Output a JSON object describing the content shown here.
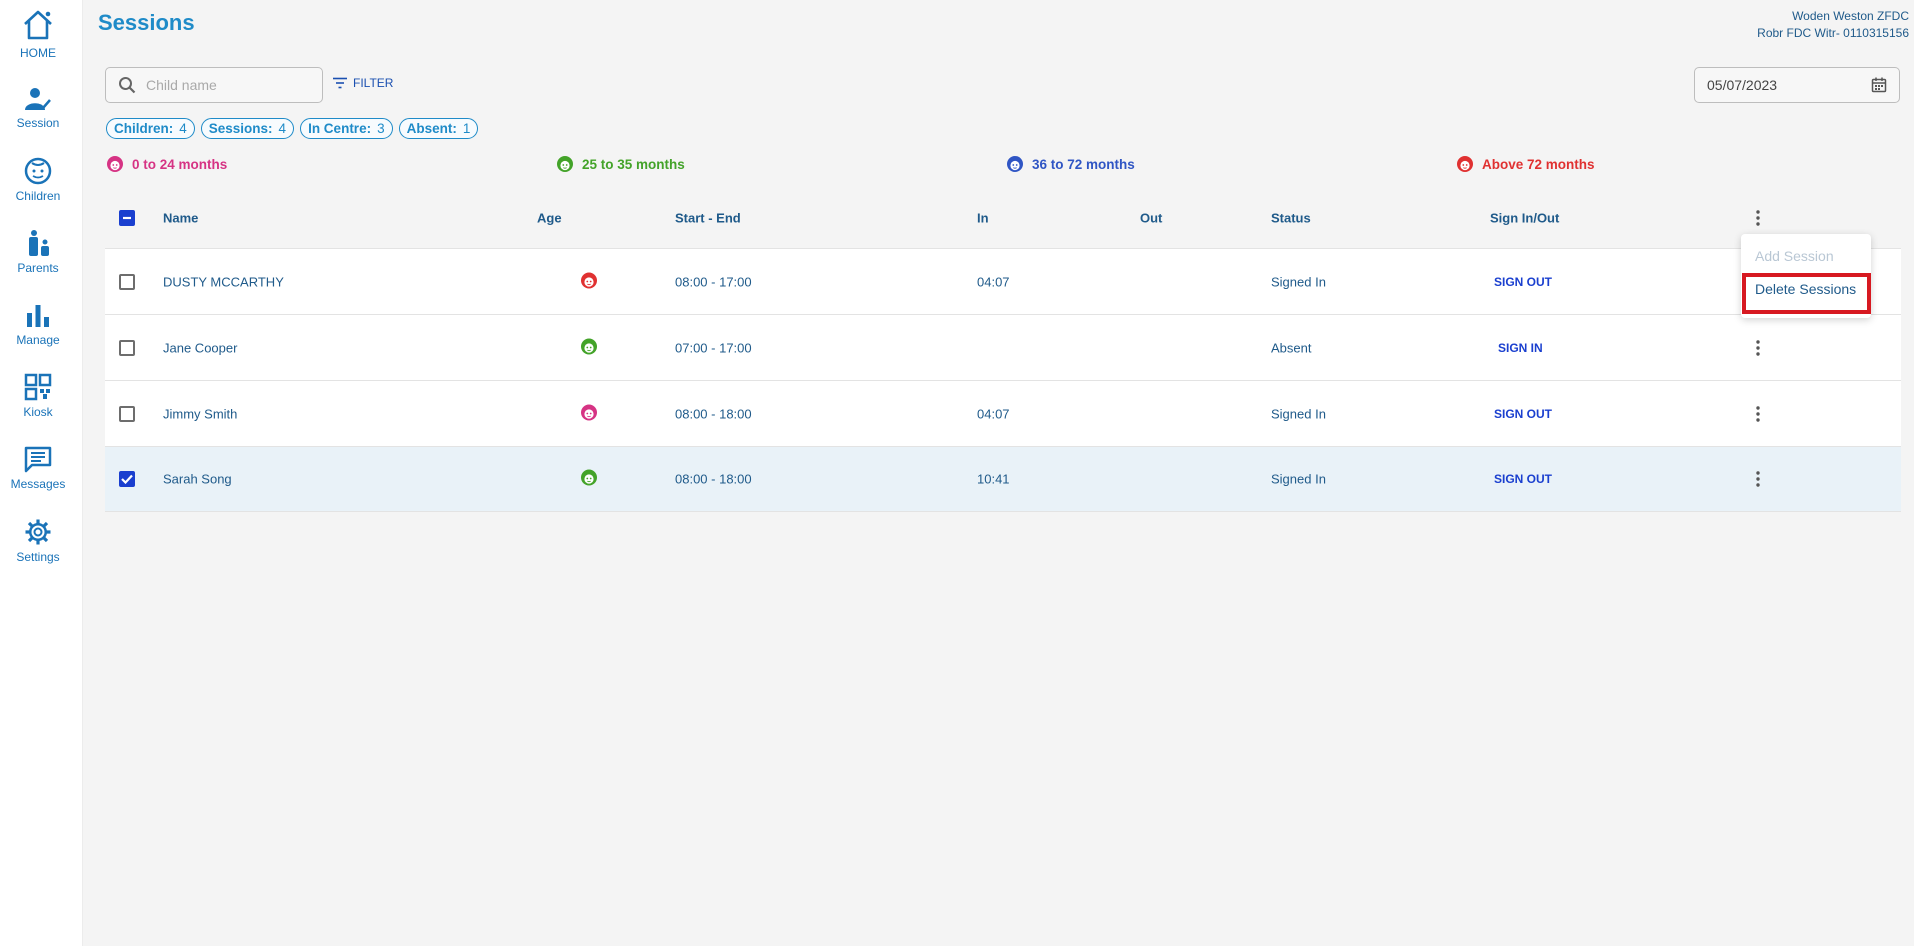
{
  "sidebar": {
    "items": [
      {
        "label": "HOME",
        "icon": "home-icon"
      },
      {
        "label": "Session",
        "icon": "session-icon"
      },
      {
        "label": "Children",
        "icon": "children-icon"
      },
      {
        "label": "Parents",
        "icon": "parents-icon"
      },
      {
        "label": "Manage",
        "icon": "bar-chart-icon"
      },
      {
        "label": "Kiosk",
        "icon": "qr-code-icon"
      },
      {
        "label": "Messages",
        "icon": "message-icon"
      },
      {
        "label": "Settings",
        "icon": "gear-icon"
      }
    ]
  },
  "header": {
    "title": "Sessions",
    "org_line1": "Woden Weston ZFDC",
    "org_line2": "Robr FDC Witr- 0110315156"
  },
  "toolbar": {
    "search_placeholder": "Child name",
    "filter_label": "FILTER",
    "date_value": "05/07/2023"
  },
  "summary": [
    {
      "label": "Children:",
      "value": "4"
    },
    {
      "label": "Sessions:",
      "value": "4"
    },
    {
      "label": "In Centre:",
      "value": "3"
    },
    {
      "label": "Absent:",
      "value": "1"
    }
  ],
  "age_legend": [
    {
      "label": "0 to 24 months",
      "color": "#d63384"
    },
    {
      "label": "25 to 35 months",
      "color": "#43a329"
    },
    {
      "label": "36 to 72 months",
      "color": "#2f55c4"
    },
    {
      "label": "Above 72 months",
      "color": "#e03131"
    }
  ],
  "table": {
    "columns": [
      "Name",
      "Age",
      "Start - End",
      "In",
      "Out",
      "Status",
      "Sign In/Out"
    ],
    "rows": [
      {
        "name": "DUSTY MCCARTHY",
        "age_group": 3,
        "time": "08:00 - 17:00",
        "in": "04:07",
        "out": "",
        "status": "Signed In",
        "action": "SIGN OUT",
        "checked": false
      },
      {
        "name": "Jane Cooper",
        "age_group": 1,
        "time": "07:00 - 17:00",
        "in": "",
        "out": "",
        "status": "Absent",
        "action": "SIGN IN",
        "checked": false
      },
      {
        "name": "Jimmy Smith",
        "age_group": 0,
        "time": "08:00 - 18:00",
        "in": "04:07",
        "out": "",
        "status": "Signed In",
        "action": "SIGN OUT",
        "checked": false
      },
      {
        "name": "Sarah Song",
        "age_group": 1,
        "time": "08:00 - 18:00",
        "in": "10:41",
        "out": "",
        "status": "Signed In",
        "action": "SIGN OUT",
        "checked": true
      }
    ]
  },
  "menu": {
    "add_label": "Add Session",
    "delete_label": "Delete Sessions"
  }
}
